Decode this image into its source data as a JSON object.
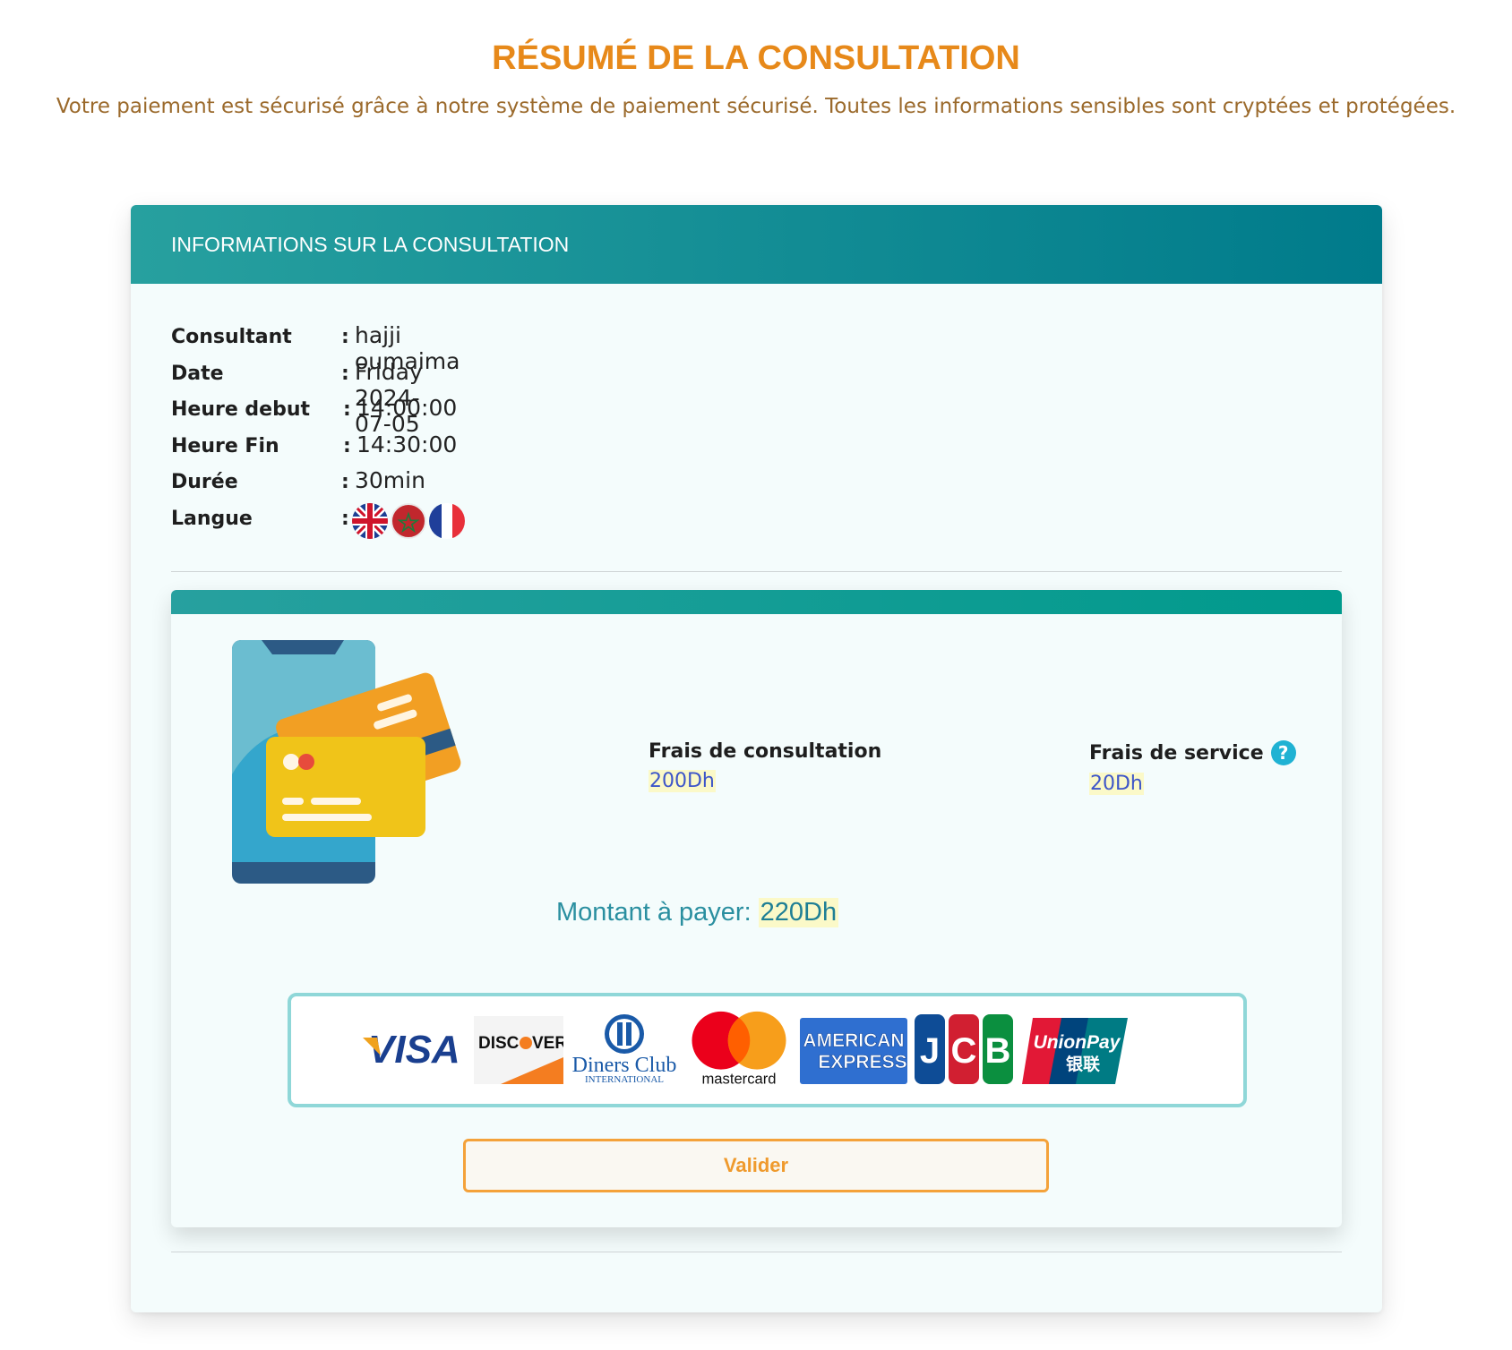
{
  "header": {
    "title": "RÉSUMÉ DE LA CONSULTATION",
    "subtitle": "Votre paiement est sécurisé grâce à notre système de paiement sécurisé. Toutes les informations sensibles sont cryptées et protégées."
  },
  "card": {
    "title": "INFORMATIONS SUR LA CONSULTATION",
    "details": [
      {
        "label": "Consultant",
        "value": "hajji oumaima"
      },
      {
        "label": "Date",
        "value": "Friday 2024-07-05"
      },
      {
        "label": "Heure debut",
        "value": "14:00:00"
      },
      {
        "label": "Heure Fin",
        "value": "14:30:00"
      },
      {
        "label": "Durée",
        "value": "30min"
      },
      {
        "label": "Langue",
        "value": ""
      }
    ],
    "colon": ":",
    "languages": [
      "uk-flag-icon",
      "morocco-flag-icon",
      "france-flag-icon"
    ]
  },
  "payment": {
    "consultation_fee_label": "Frais de consultation",
    "consultation_fee_value": "200Dh",
    "service_fee_label": "Frais de service",
    "service_fee_value": "20Dh",
    "help_icon_glyph": "?",
    "total_label": "Montant à payer:",
    "total_value": "220Dh",
    "card_brands": [
      "visa",
      "discover",
      "diners-club",
      "mastercard",
      "american-express",
      "jcb",
      "unionpay"
    ],
    "brand_text": {
      "visa": "VISA",
      "discover_1": "DISC",
      "discover_2": "VER",
      "diners_1": "Diners Club",
      "diners_2": "INTERNATIONAL",
      "mastercard": "mastercard",
      "amex_1": "AMERICAN",
      "amex_2": "EXPRESS",
      "jcb": [
        "J",
        "C",
        "B"
      ],
      "unionpay_1": "UnionPay",
      "unionpay_2": "银联"
    },
    "validate_label": "Valider"
  },
  "colors": {
    "title": "#e7891a",
    "subtitle": "#9b6a2c",
    "header_gradient_start": "#27a09f",
    "header_gradient_end": "#007b8b",
    "accent_orange": "#f4a23a",
    "highlight": "#fbf9c8"
  }
}
